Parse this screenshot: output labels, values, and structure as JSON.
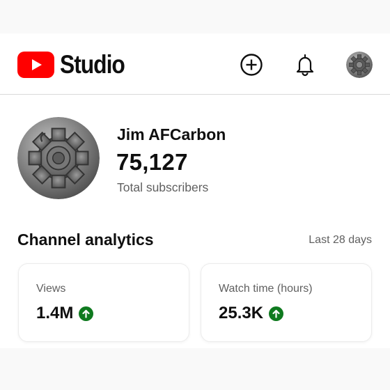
{
  "app": {
    "title": "Studio",
    "logo_icon": "youtube-play-icon",
    "brand_color": "#ff0000"
  },
  "header": {
    "create_icon": "add-circle-icon",
    "notifications_icon": "bell-icon",
    "account_icon": "avatar-gear-icon"
  },
  "channel": {
    "name": "Jim AFCarbon",
    "subscriber_count": "75,127",
    "subscriber_label": "Total subscribers",
    "avatar": "gear-avatar"
  },
  "analytics": {
    "title": "Channel analytics",
    "range": "Last 28 days",
    "cards": [
      {
        "label": "Views",
        "value": "1.4M",
        "trend": "up",
        "trend_color": "#0f7a1f"
      },
      {
        "label": "Watch time (hours)",
        "value": "25.3K",
        "trend": "up",
        "trend_color": "#0f7a1f"
      }
    ]
  }
}
